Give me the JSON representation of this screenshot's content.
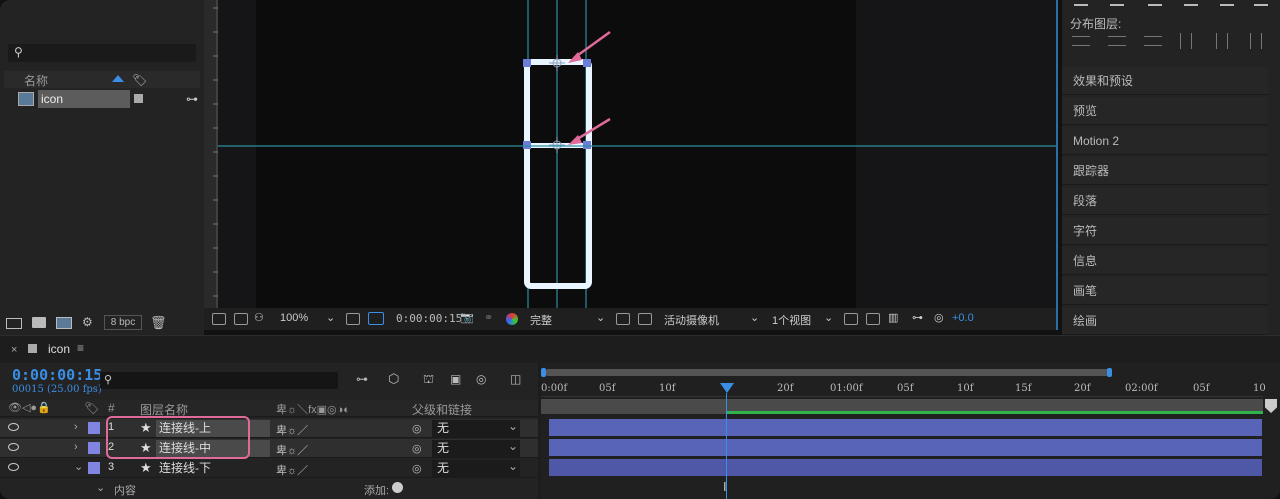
{
  "project": {
    "search_placeholder": "",
    "col_name": "名称",
    "item_name": "icon",
    "bpc_label": "8 bpc"
  },
  "viewer": {
    "zoom": "100%",
    "timecode": "0:00:00:15",
    "quality": "完整",
    "camera": "活动摄像机",
    "views": "1个视图",
    "exposure": "+0.0"
  },
  "right_panel": {
    "distribute_label": "分布图层:",
    "items": [
      "效果和预设",
      "预览",
      "Motion 2",
      "跟踪器",
      "段落",
      "字符",
      "信息",
      "画笔",
      "绘画"
    ]
  },
  "timeline": {
    "comp_tab": "icon",
    "timecode": "0:00:00:15",
    "fps_sub": "00015 (25.00 fps)",
    "col_num": "#",
    "col_layer_name": "图层名称",
    "col_parent": "父级和链接",
    "layers": [
      {
        "num": "1",
        "name": "连接线-上",
        "parent": "无"
      },
      {
        "num": "2",
        "name": "连接线-中",
        "parent": "无"
      },
      {
        "num": "3",
        "name": "连接线-下",
        "parent": "无"
      }
    ],
    "content_label": "内容",
    "add_label": "添加:",
    "ruler_ticks": [
      "0:00f",
      "05f",
      "10f",
      "20f",
      "01:00f",
      "05f",
      "10f",
      "15f",
      "20f",
      "02:00f",
      "05f",
      "10"
    ]
  },
  "colors": {
    "accent": "#2b6fa8",
    "highlight": "#e06a9a",
    "track": "#4e58a6",
    "label": "#7f85e0"
  }
}
